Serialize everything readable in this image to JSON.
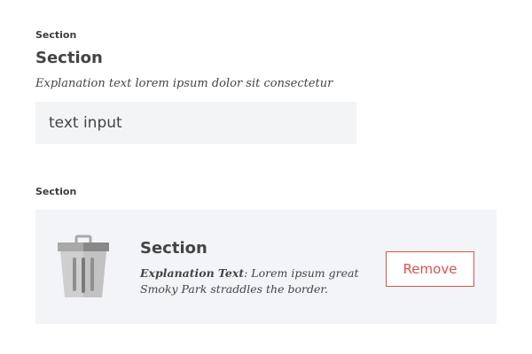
{
  "section1": {
    "label": "Section",
    "title": "Section",
    "explanation": "Explanation text lorem ipsum dolor sit consectetur",
    "input": {
      "value": "text input"
    }
  },
  "section2": {
    "label": "Section",
    "card": {
      "icon": "trash-icon",
      "title": "Section",
      "explanation_label": "Explanation Text",
      "explanation_separator": ":",
      "explanation_body": " Lorem ipsum great Smoky Park straddles the border.",
      "remove_label": "Remove"
    }
  },
  "colors": {
    "input_background": "#f3f4f6",
    "card_background": "#f2f4f7",
    "danger": "#d9534f",
    "text": "#444444"
  }
}
